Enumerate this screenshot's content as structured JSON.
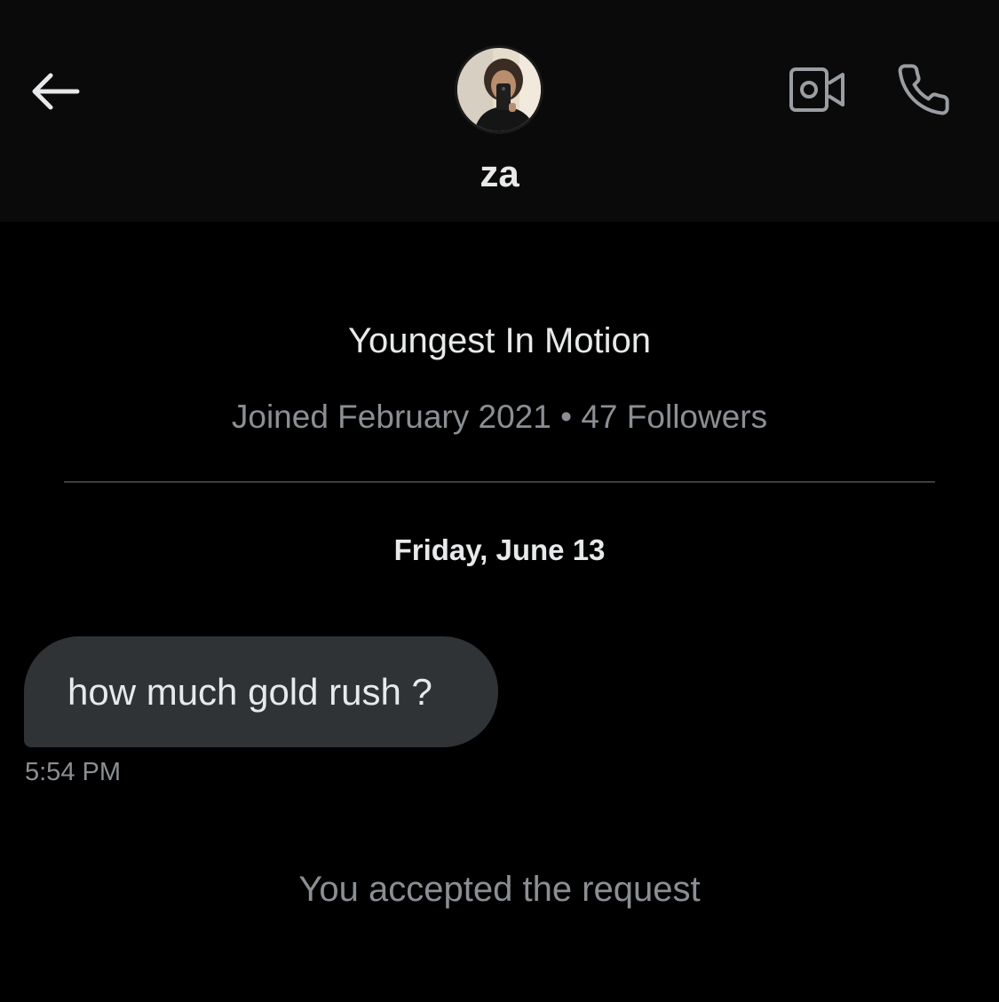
{
  "header": {
    "contact_name": "za",
    "icons": {
      "back": "arrow-left-icon",
      "video": "video-camera-icon",
      "call": "phone-icon"
    }
  },
  "profile": {
    "display_name": "Youngest In Motion",
    "joined": "Joined February 2021",
    "separator": " • ",
    "followers": "47 Followers"
  },
  "conversation": {
    "date_label": "Friday, June 13",
    "messages": [
      {
        "text": "how much gold rush ?",
        "time": "5:54 PM"
      }
    ],
    "system_note": "You accepted the request"
  },
  "colors": {
    "background": "#000000",
    "header_background": "#0a0a0a",
    "bubble_background": "#2f3336",
    "primary_text": "#e7e9ea",
    "secondary_text": "#8b8f94",
    "icon_color": "#9a9da1"
  }
}
